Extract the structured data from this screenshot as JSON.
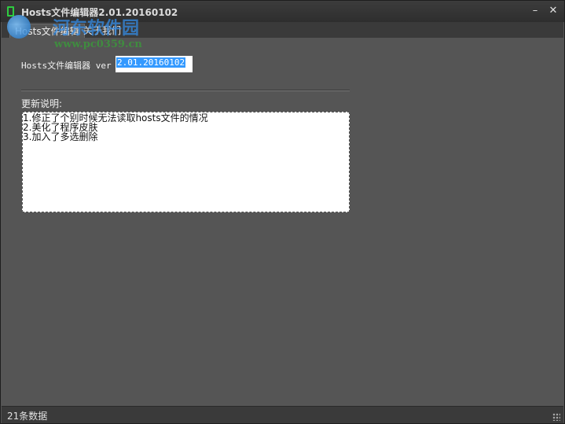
{
  "window": {
    "title": "Hosts文件编辑器2.01.20160102",
    "minimize_glyph": "–",
    "close_glyph": "✕"
  },
  "watermark": {
    "brand": "河东软件园",
    "url": "www.pc0359.cn"
  },
  "tabs": [
    {
      "label": "Hosts文件编辑",
      "active": true
    },
    {
      "label": "关于我们",
      "active": false
    }
  ],
  "about": {
    "version_label": "Hosts文件编辑器 ver",
    "version_value": "2.01.20160102",
    "changelog_label": "更新说明:",
    "changelog_lines": [
      "1.修正了个别时候无法读取hosts文件的情况",
      "2.美化了程序皮肤",
      "3.加入了多选删除"
    ]
  },
  "status": {
    "text": "21条数据"
  },
  "colors": {
    "background": "#555555",
    "titlebar": "#333333",
    "selection": "#3399ff",
    "app_icon": "#2ecc40"
  },
  "icons": {
    "app": "app-icon",
    "minimize": "minimize-icon",
    "close": "close-icon",
    "grip": "resize-grip-icon"
  }
}
